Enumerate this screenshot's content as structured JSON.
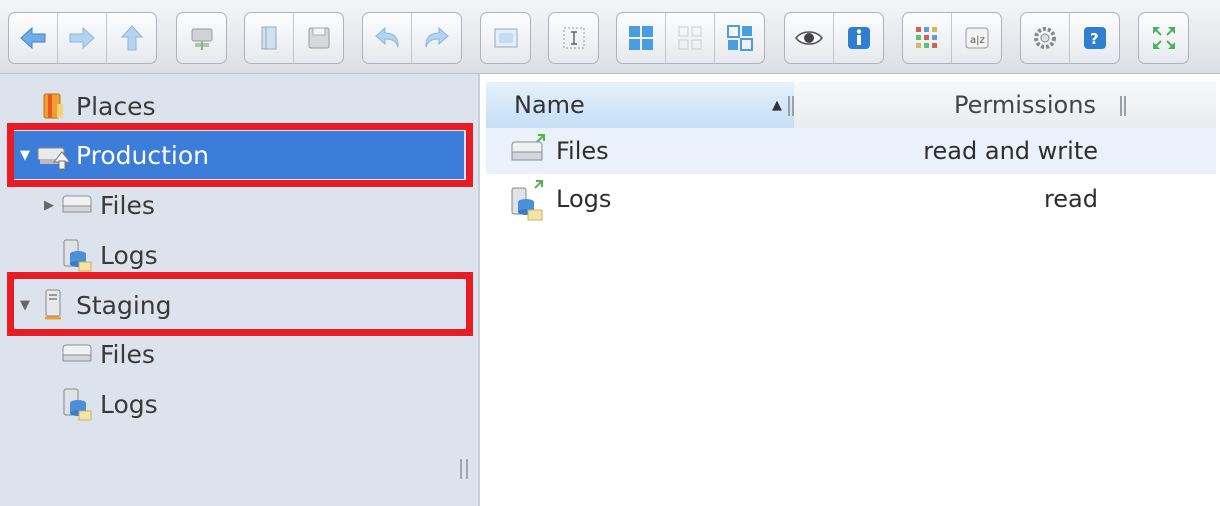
{
  "toolbar": {
    "groups": [
      [
        "back-arrow-icon",
        "forward-arrow-icon",
        "up-arrow-icon"
      ],
      [
        "connect-drive-icon"
      ],
      [
        "book-icon",
        "save-disk-icon"
      ],
      [
        "undo-icon",
        "redo-icon"
      ],
      [
        "image-window-icon"
      ],
      [
        "rename-icon"
      ],
      [
        "large-tiles-icon",
        "small-tiles-icon",
        "list-tiles-icon"
      ],
      [
        "eye-icon",
        "info-icon"
      ],
      [
        "grid-apps-icon",
        "sort-az-icon"
      ],
      [
        "settings-gear-icon",
        "help-icon"
      ],
      [
        "fullscreen-icon"
      ]
    ]
  },
  "tree": {
    "places_label": "Places",
    "production_label": "Production",
    "production_files_label": "Files",
    "production_logs_label": "Logs",
    "staging_label": "Staging",
    "staging_files_label": "Files",
    "staging_logs_label": "Logs"
  },
  "list": {
    "columns": {
      "name": "Name",
      "permissions": "Permissions"
    },
    "rows": [
      {
        "name": "Files",
        "permissions": "read and write"
      },
      {
        "name": "Logs",
        "permissions": "read"
      }
    ]
  },
  "colors": {
    "selection": "#3b7dd8",
    "highlight_box": "#e81c24",
    "tree_bg": "#dde3ec"
  }
}
